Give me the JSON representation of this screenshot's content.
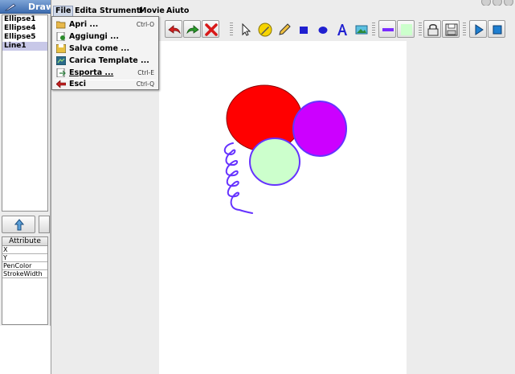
{
  "left_window": {
    "title": "Drawi",
    "shapes": [
      "Ellipse1",
      "Ellipse4",
      "Ellipse5",
      "Line1"
    ],
    "selected_shape": "Line1",
    "attributes_header": "Attribute",
    "attributes": [
      "X",
      "Y",
      "PenColor",
      "StrokeWidth"
    ]
  },
  "menubar": {
    "items": [
      "File",
      "Edita",
      "Strumenti",
      "Movie",
      "Aiuto"
    ],
    "active": "File"
  },
  "file_menu": {
    "items": [
      {
        "label": "Apri ...",
        "shortcut": "Ctrl-O",
        "icon": "folder-open-icon"
      },
      {
        "label": "Aggiungi ...",
        "shortcut": "",
        "icon": "add-document-icon"
      },
      {
        "label": "Salva come ...",
        "shortcut": "",
        "icon": "save-as-icon"
      },
      {
        "label": "Carica Template ...",
        "shortcut": "",
        "icon": "template-icon"
      },
      {
        "label": "Esporta ...",
        "shortcut": "Ctrl-E",
        "icon": "export-icon"
      },
      {
        "label": "Esci",
        "shortcut": "Ctrl-Q",
        "icon": "exit-icon"
      }
    ]
  },
  "toolbar": {
    "tools": [
      "undo-icon",
      "redo-icon",
      "delete-icon",
      "select-arrow-icon",
      "pen-icon",
      "pencil-icon",
      "rectangle-icon",
      "ellipse-icon",
      "text-icon",
      "image-icon",
      "stroke-color-icon",
      "fill-color-icon",
      "lock-icon",
      "save-icon",
      "play-icon",
      "stop-icon"
    ]
  },
  "canvas": {
    "shapes": [
      {
        "name": "Ellipse1",
        "kind": "ellipse",
        "fill": "#ff0000",
        "stroke": "#8a0000"
      },
      {
        "name": "Ellipse4",
        "kind": "ellipse",
        "fill": "#cc00ff",
        "stroke": "#6633ff"
      },
      {
        "name": "Ellipse5",
        "kind": "ellipse",
        "fill": "#ccffcc",
        "stroke": "#6633ff"
      },
      {
        "name": "Line1",
        "kind": "freehand-line",
        "stroke": "#6633ff"
      }
    ]
  },
  "colors": {
    "title_bar": "#3d6cb0",
    "canvas_bg": "#ffffff",
    "panel_bg": "#ececec"
  }
}
